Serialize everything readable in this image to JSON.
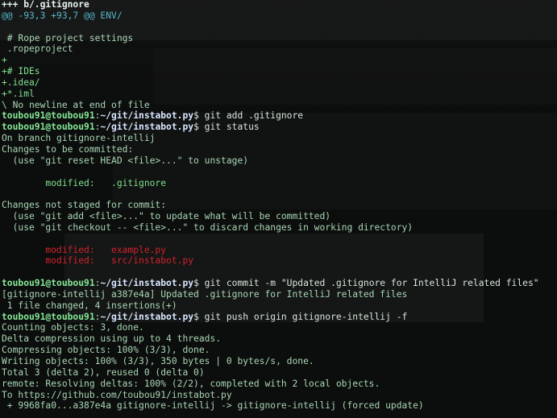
{
  "terminal": {
    "lines": [
      [
        {
          "t": "+++ b/.gitignore",
          "c": "c-bold-white"
        }
      ],
      [
        {
          "t": "@@ -93,3 +93,7 @@ ENV/",
          "c": "c-cyan"
        }
      ],
      [
        {
          "t": "",
          "c": "c-default"
        }
      ],
      [
        {
          "t": " # Rope project settings",
          "c": "c-default"
        }
      ],
      [
        {
          "t": " .ropeproject",
          "c": "c-default"
        }
      ],
      [
        {
          "t": "+",
          "c": "c-green"
        }
      ],
      [
        {
          "t": "+# IDEs",
          "c": "c-green"
        }
      ],
      [
        {
          "t": "+.idea/",
          "c": "c-green"
        }
      ],
      [
        {
          "t": "+*.iml",
          "c": "c-green"
        }
      ],
      [
        {
          "t": "\\ No newline at end of file",
          "c": "c-default"
        }
      ],
      [
        {
          "t": "toubou91@toubou91",
          "c": "c-green-bold"
        },
        {
          "t": ":",
          "c": "c-default"
        },
        {
          "t": "~/git/instabot.py",
          "c": "c-path"
        },
        {
          "t": "$ git add .gitignore",
          "c": "c-white"
        }
      ],
      [
        {
          "t": "toubou91@toubou91",
          "c": "c-green-bold"
        },
        {
          "t": ":",
          "c": "c-default"
        },
        {
          "t": "~/git/instabot.py",
          "c": "c-path"
        },
        {
          "t": "$ git status",
          "c": "c-white"
        }
      ],
      [
        {
          "t": "On branch gitignore-intellij",
          "c": "c-default"
        }
      ],
      [
        {
          "t": "Changes to be committed:",
          "c": "c-default"
        }
      ],
      [
        {
          "t": "  (use \"git reset HEAD <file>...\" to unstage)",
          "c": "c-default"
        }
      ],
      [
        {
          "t": "",
          "c": "c-default"
        }
      ],
      [
        {
          "t": "        modified:   .gitignore",
          "c": "c-green"
        }
      ],
      [
        {
          "t": "",
          "c": "c-default"
        }
      ],
      [
        {
          "t": "Changes not staged for commit:",
          "c": "c-default"
        }
      ],
      [
        {
          "t": "  (use \"git add <file>...\" to update what will be committed)",
          "c": "c-default"
        }
      ],
      [
        {
          "t": "  (use \"git checkout -- <file>...\" to discard changes in working directory)",
          "c": "c-default"
        }
      ],
      [
        {
          "t": "",
          "c": "c-default"
        }
      ],
      [
        {
          "t": "        modified:   example.py",
          "c": "c-red"
        }
      ],
      [
        {
          "t": "        modified:   src/instabot.py",
          "c": "c-red"
        }
      ],
      [
        {
          "t": "",
          "c": "c-default"
        }
      ],
      [
        {
          "t": "toubou91@toubou91",
          "c": "c-green-bold"
        },
        {
          "t": ":",
          "c": "c-default"
        },
        {
          "t": "~/git/instabot.py",
          "c": "c-path"
        },
        {
          "t": "$ git commit -m \"Updated .gitignore for IntelliJ related files\"",
          "c": "c-white"
        }
      ],
      [
        {
          "t": "[gitignore-intellij a387e4a] Updated .gitignore for IntelliJ related files",
          "c": "c-default"
        }
      ],
      [
        {
          "t": " 1 file changed, 4 insertions(+)",
          "c": "c-default"
        }
      ],
      [
        {
          "t": "toubou91@toubou91",
          "c": "c-green-bold"
        },
        {
          "t": ":",
          "c": "c-default"
        },
        {
          "t": "~/git/instabot.py",
          "c": "c-path"
        },
        {
          "t": "$ git push origin gitignore-intellij -f",
          "c": "c-white"
        }
      ],
      [
        {
          "t": "Counting objects: 3, done.",
          "c": "c-default"
        }
      ],
      [
        {
          "t": "Delta compression using up to 4 threads.",
          "c": "c-default"
        }
      ],
      [
        {
          "t": "Compressing objects: 100% (3/3), done.",
          "c": "c-default"
        }
      ],
      [
        {
          "t": "Writing objects: 100% (3/3), 350 bytes | 0 bytes/s, done.",
          "c": "c-default"
        }
      ],
      [
        {
          "t": "Total 3 (delta 2), reused 0 (delta 0)",
          "c": "c-default"
        }
      ],
      [
        {
          "t": "remote: Resolving deltas: 100% (2/2), completed with 2 local objects.",
          "c": "c-default"
        }
      ],
      [
        {
          "t": "To https://github.com/toubou91/instabot.py",
          "c": "c-default"
        }
      ],
      [
        {
          "t": " + 9968fa0...a387e4a gitignore-intellij -> gitignore-intellij (forced update)",
          "c": "c-default"
        }
      ]
    ]
  }
}
